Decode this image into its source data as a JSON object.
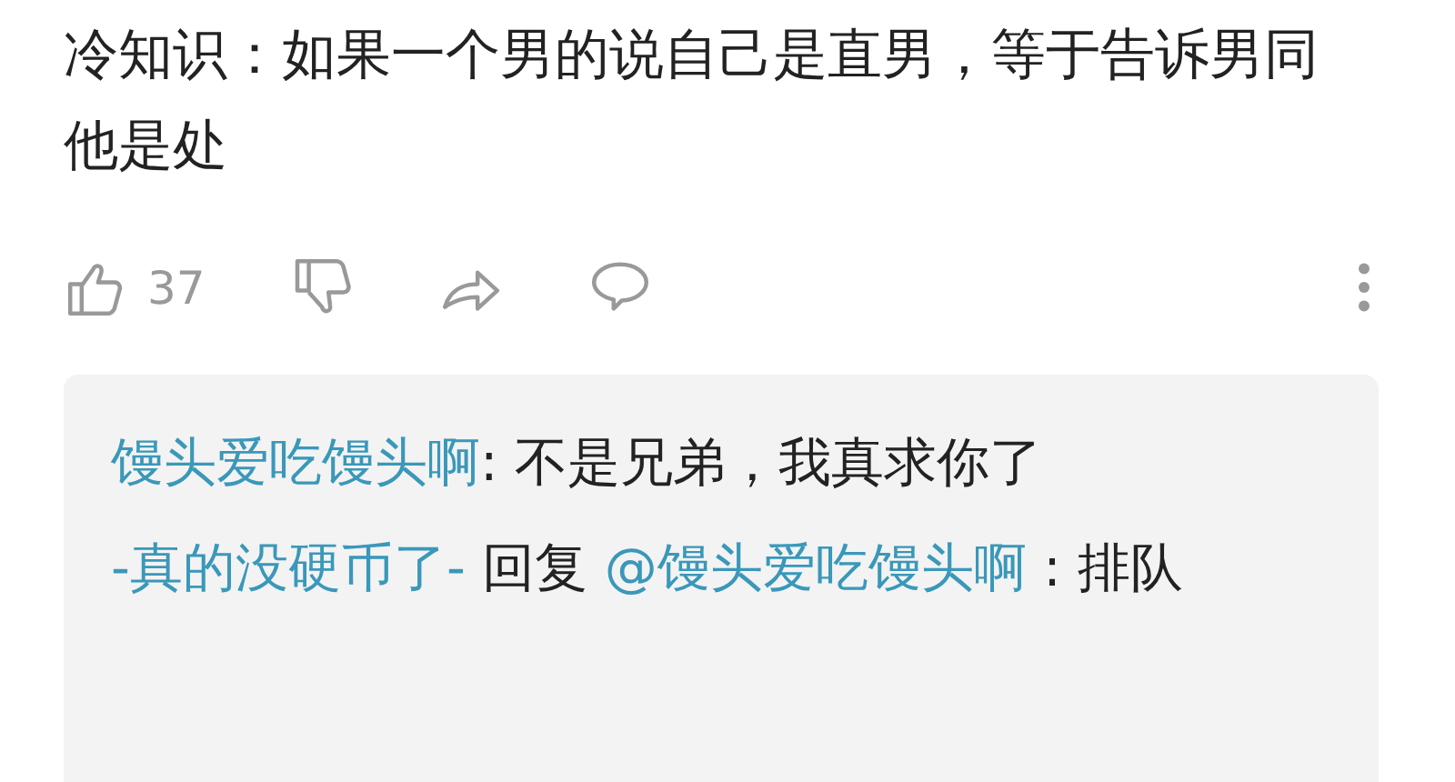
{
  "comment": {
    "text": "冷知识：如果一个男的说自己是直男，等于告诉男同他是处"
  },
  "actions": {
    "like_count": "37"
  },
  "replies": [
    {
      "segments": [
        {
          "kind": "user",
          "text": "馒头爱吃馒头啊"
        },
        {
          "kind": "text",
          "text": ": 不是兄弟，我真求你了"
        }
      ]
    },
    {
      "segments": [
        {
          "kind": "user",
          "text": "-真的没硬币了-"
        },
        {
          "kind": "text",
          "text": " 回复 "
        },
        {
          "kind": "user",
          "text": "@馒头爱吃馒头啊"
        },
        {
          "kind": "text",
          "text": " : 排队"
        }
      ]
    }
  ]
}
